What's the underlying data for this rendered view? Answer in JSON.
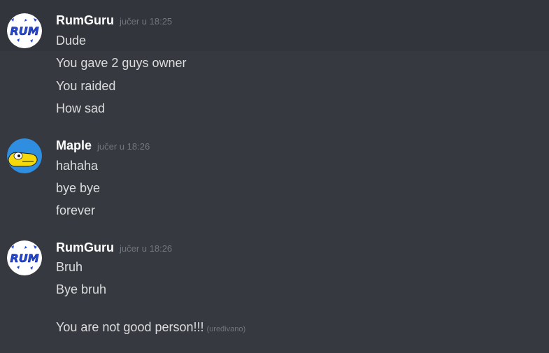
{
  "groups": [
    {
      "author": "RumGuru",
      "timestamp": "jučer u 18:25",
      "avatar": "rumguru-avatar",
      "messages": [
        "Dude",
        "You gave 2 guys owner",
        "You raided",
        "How sad"
      ]
    },
    {
      "author": "Maple",
      "timestamp": "jučer u 18:26",
      "avatar": "maple-avatar",
      "messages": [
        "hahaha",
        "bye bye",
        "forever"
      ]
    },
    {
      "author": "RumGuru",
      "timestamp": "jučer u 18:26",
      "avatar": "rumguru-avatar",
      "messages": [
        "Bruh",
        "Bye bruh",
        "You are not good person!!!"
      ],
      "edited_label": "(uređivano)"
    }
  ],
  "colors": {
    "background": "#36393f",
    "hover": "#32353b",
    "author": "#ffffff",
    "message": "#dcddde",
    "timestamp": "#72767d",
    "rum_logo": "#2549d6",
    "maple_avatar": "#2f8ee0"
  }
}
